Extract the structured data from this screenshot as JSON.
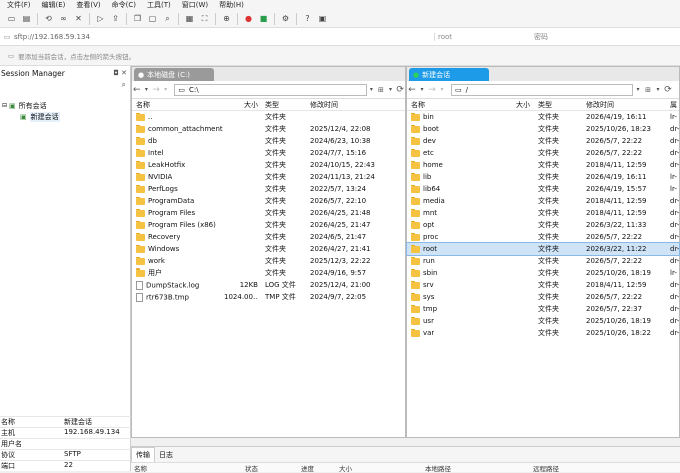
{
  "menu": [
    "文件(F)",
    "编辑(E)",
    "查看(V)",
    "命令(C)",
    "工具(T)",
    "窗口(W)",
    "帮助(H)"
  ],
  "address": {
    "url": "sftp://192.168.59.134",
    "user_placeholder": "root",
    "password_placeholder": "密码"
  },
  "hint": "要添加当前会话，点击左侧的箭头按钮。",
  "session_manager": {
    "title": "Session Manager",
    "tree": [
      {
        "label": "所有会话"
      },
      {
        "label": "新建会话"
      }
    ],
    "properties": [
      {
        "key": "名称",
        "value": "新建会话"
      },
      {
        "key": "主机",
        "value": "192.168.49.134"
      },
      {
        "key": "用户名",
        "value": ""
      },
      {
        "key": "协议",
        "value": "SFTP"
      },
      {
        "key": "端口",
        "value": "22"
      }
    ]
  },
  "local": {
    "tab": "本地磁盘 (C:)",
    "path": "C:\\",
    "columns": {
      "name": "名称",
      "size": "大小",
      "type": "类型",
      "modified": "修改时间"
    },
    "rows": [
      {
        "name": "..",
        "size": "",
        "type": "文件夹",
        "modified": "",
        "icon": "folder"
      },
      {
        "name": "common_attachment",
        "size": "",
        "type": "文件夹",
        "modified": "2025/12/4, 22:08",
        "icon": "folder"
      },
      {
        "name": "db",
        "size": "",
        "type": "文件夹",
        "modified": "2024/6/23, 10:38",
        "icon": "folder"
      },
      {
        "name": "Intel",
        "size": "",
        "type": "文件夹",
        "modified": "2024/7/7, 15:16",
        "icon": "folder"
      },
      {
        "name": "LeakHotfix",
        "size": "",
        "type": "文件夹",
        "modified": "2024/10/15, 22:43",
        "icon": "folder"
      },
      {
        "name": "NVIDIA",
        "size": "",
        "type": "文件夹",
        "modified": "2024/11/13, 21:24",
        "icon": "folder"
      },
      {
        "name": "PerfLogs",
        "size": "",
        "type": "文件夹",
        "modified": "2022/5/7, 13:24",
        "icon": "folder"
      },
      {
        "name": "ProgramData",
        "size": "",
        "type": "文件夹",
        "modified": "2026/5/7, 22:10",
        "icon": "folder"
      },
      {
        "name": "Program Files",
        "size": "",
        "type": "文件夹",
        "modified": "2026/4/25, 21:48",
        "icon": "folder"
      },
      {
        "name": "Program Files (x86)",
        "size": "",
        "type": "文件夹",
        "modified": "2026/4/25, 21:47",
        "icon": "folder"
      },
      {
        "name": "Recovery",
        "size": "",
        "type": "文件夹",
        "modified": "2024/6/5, 21:47",
        "icon": "folder"
      },
      {
        "name": "Windows",
        "size": "",
        "type": "文件夹",
        "modified": "2026/4/27, 21:41",
        "icon": "folder"
      },
      {
        "name": "work",
        "size": "",
        "type": "文件夹",
        "modified": "2025/12/3, 22:22",
        "icon": "folder"
      },
      {
        "name": "用户",
        "size": "",
        "type": "文件夹",
        "modified": "2024/9/16, 9:57",
        "icon": "folder"
      },
      {
        "name": "DumpStack.log",
        "size": "12KB",
        "type": "LOG 文件",
        "modified": "2025/12/4, 21:00",
        "icon": "file"
      },
      {
        "name": "rtr673B.tmp",
        "size": "1024.00...",
        "type": "TMP 文件",
        "modified": "2024/9/7, 22:05",
        "icon": "file"
      }
    ]
  },
  "remote": {
    "tab": "新建会话",
    "path": "/",
    "columns": {
      "name": "名称",
      "size": "大小",
      "type": "类型",
      "modified": "修改时间",
      "perm": "属"
    },
    "rows": [
      {
        "name": "bin",
        "type": "文件夹",
        "modified": "2026/4/19, 16:11",
        "perm": "lr-",
        "icon": "folder"
      },
      {
        "name": "boot",
        "type": "文件夹",
        "modified": "2025/10/26, 18:23",
        "perm": "dr-",
        "icon": "folder"
      },
      {
        "name": "dev",
        "type": "文件夹",
        "modified": "2026/5/7, 22:22",
        "perm": "dr-",
        "icon": "folder"
      },
      {
        "name": "etc",
        "type": "文件夹",
        "modified": "2026/5/7, 22:22",
        "perm": "dr-",
        "icon": "folder"
      },
      {
        "name": "home",
        "type": "文件夹",
        "modified": "2018/4/11, 12:59",
        "perm": "dr-",
        "icon": "folder"
      },
      {
        "name": "lib",
        "type": "文件夹",
        "modified": "2026/4/19, 16:11",
        "perm": "lr-",
        "icon": "folder"
      },
      {
        "name": "lib64",
        "type": "文件夹",
        "modified": "2026/4/19, 15:57",
        "perm": "lr-",
        "icon": "folder"
      },
      {
        "name": "media",
        "type": "文件夹",
        "modified": "2018/4/11, 12:59",
        "perm": "dr-",
        "icon": "folder"
      },
      {
        "name": "mnt",
        "type": "文件夹",
        "modified": "2018/4/11, 12:59",
        "perm": "dr-",
        "icon": "folder"
      },
      {
        "name": "opt",
        "type": "文件夹",
        "modified": "2026/3/22, 11:33",
        "perm": "dr-",
        "icon": "folder"
      },
      {
        "name": "proc",
        "type": "文件夹",
        "modified": "2026/5/7, 22:22",
        "perm": "dr-",
        "icon": "folder"
      },
      {
        "name": "root",
        "type": "文件夹",
        "modified": "2026/3/22, 11:22",
        "perm": "dr-",
        "icon": "folder"
      },
      {
        "name": "run",
        "type": "文件夹",
        "modified": "2026/5/7, 22:22",
        "perm": "dr-",
        "icon": "folder"
      },
      {
        "name": "sbin",
        "type": "文件夹",
        "modified": "2025/10/26, 18:19",
        "perm": "lr-",
        "icon": "folder"
      },
      {
        "name": "srv",
        "type": "文件夹",
        "modified": "2018/4/11, 12:59",
        "perm": "dr-",
        "icon": "folder"
      },
      {
        "name": "sys",
        "type": "文件夹",
        "modified": "2026/5/7, 22:22",
        "perm": "dr-",
        "icon": "folder"
      },
      {
        "name": "tmp",
        "type": "文件夹",
        "modified": "2026/5/7, 22:37",
        "perm": "dr-",
        "icon": "folder"
      },
      {
        "name": "usr",
        "type": "文件夹",
        "modified": "2025/10/26, 18:19",
        "perm": "dr-",
        "icon": "folder"
      },
      {
        "name": "var",
        "type": "文件夹",
        "modified": "2025/10/26, 18:22",
        "perm": "dr-",
        "icon": "folder"
      }
    ],
    "selected": "root"
  },
  "bottom": {
    "tabs": [
      "传输",
      "日志"
    ],
    "columns": [
      "名称",
      "状态",
      "进度",
      "大小",
      "本地路径",
      "远程路径"
    ]
  },
  "colors": {
    "local_tab": "#9a9a9a",
    "remote_tab": "#1d9be8",
    "selection": "#cfe3f7",
    "folder": "#f5c242"
  }
}
